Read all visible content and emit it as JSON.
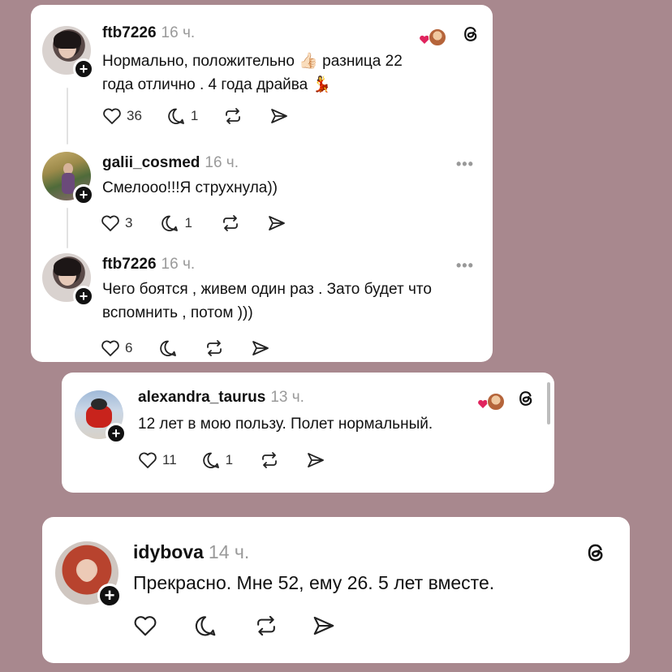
{
  "colors": {
    "background": "#a8888e",
    "card": "#ffffff",
    "heart_red": "#e0245e"
  },
  "card1": {
    "posts": [
      {
        "username": "ftb7226",
        "time": "16 ч.",
        "text_line1": "Нормально, положительно 👍🏻 разница 22",
        "text_line2": "года отлично . 4 года драйва 💃",
        "likes": "36",
        "replies": "1",
        "reposts": "",
        "has_threads_icon": true
      },
      {
        "username": "galii_cosmed",
        "time": "16 ч.",
        "text_line1": "Смелооо!!!Я струхнула))",
        "likes": "3",
        "replies": "1"
      },
      {
        "username": "ftb7226",
        "time": "16 ч.",
        "text_line1": "Чего боятся , живем один раз . Зато будет что",
        "text_line2": "вспомнить , потом )))",
        "likes": "6",
        "replies": ""
      }
    ]
  },
  "card2": {
    "username": "alexandra_taurus",
    "time": "13 ч.",
    "text_line1": "12 лет в мою пользу. Полет нормальный.",
    "likes": "11",
    "replies": "1"
  },
  "card3": {
    "username": "idybova",
    "time": "14 ч.",
    "text_line1": "Прекрасно. Мне 52, ему 26. 5 лет вместе."
  },
  "icons": {
    "plus_symbol": "+",
    "more": "•••"
  }
}
